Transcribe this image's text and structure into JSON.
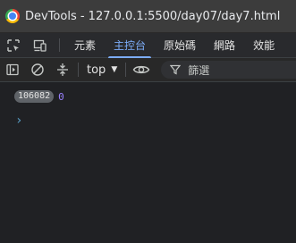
{
  "window": {
    "title": "DevTools - 127.0.0.1:5500/day07/day7.html"
  },
  "tabs": [
    {
      "label": "元素",
      "active": false
    },
    {
      "label": "主控台",
      "active": true
    },
    {
      "label": "原始碼",
      "active": false
    },
    {
      "label": "網路",
      "active": false
    },
    {
      "label": "效能",
      "active": false
    }
  ],
  "toolbar": {
    "context": "top",
    "filter_label": "篩選"
  },
  "console": {
    "entries": [
      {
        "repeat_count": "106082",
        "value": "0"
      }
    ],
    "prompt_glyph": "›"
  },
  "colors": {
    "active_tab": "#7cacf8",
    "number_value": "#9980ff",
    "prompt": "#5aa0c8"
  }
}
